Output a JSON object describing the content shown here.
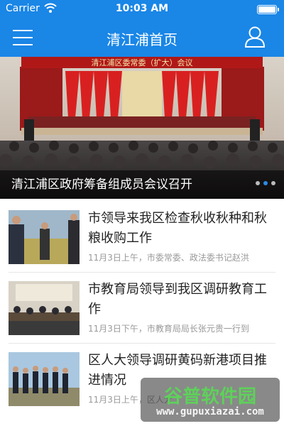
{
  "status_bar": {
    "carrier": "Carrier",
    "time": "10:03 AM"
  },
  "nav": {
    "title": "清江浦首页",
    "menu_icon": "hamburger-menu-icon",
    "user_icon": "user-profile-icon"
  },
  "banner": {
    "image_text": "清江浦区委常委（扩大）会议",
    "caption": "清江浦区政府筹备组成员会议召开",
    "page_count": 3,
    "active_index": 1
  },
  "news": [
    {
      "title": "市领导来我区检查秋收秋种和秋粮收购工作",
      "meta": "11月3日上午，市委常委、政法委书记赵洪"
    },
    {
      "title": "市教育局领导到我区调研教育工作",
      "meta": "11月3日下午，市教育局局长张元贵一行到"
    },
    {
      "title": "区人大领导调研黄码新港项目推进情况",
      "meta": "11月3日上午，区人大"
    }
  ],
  "watermark": {
    "title": "谷普软件园",
    "url": "www.gupuxiazai.com"
  },
  "colors": {
    "brand_blue": "#1a86e6",
    "watermark_green": "#5ed15a"
  }
}
